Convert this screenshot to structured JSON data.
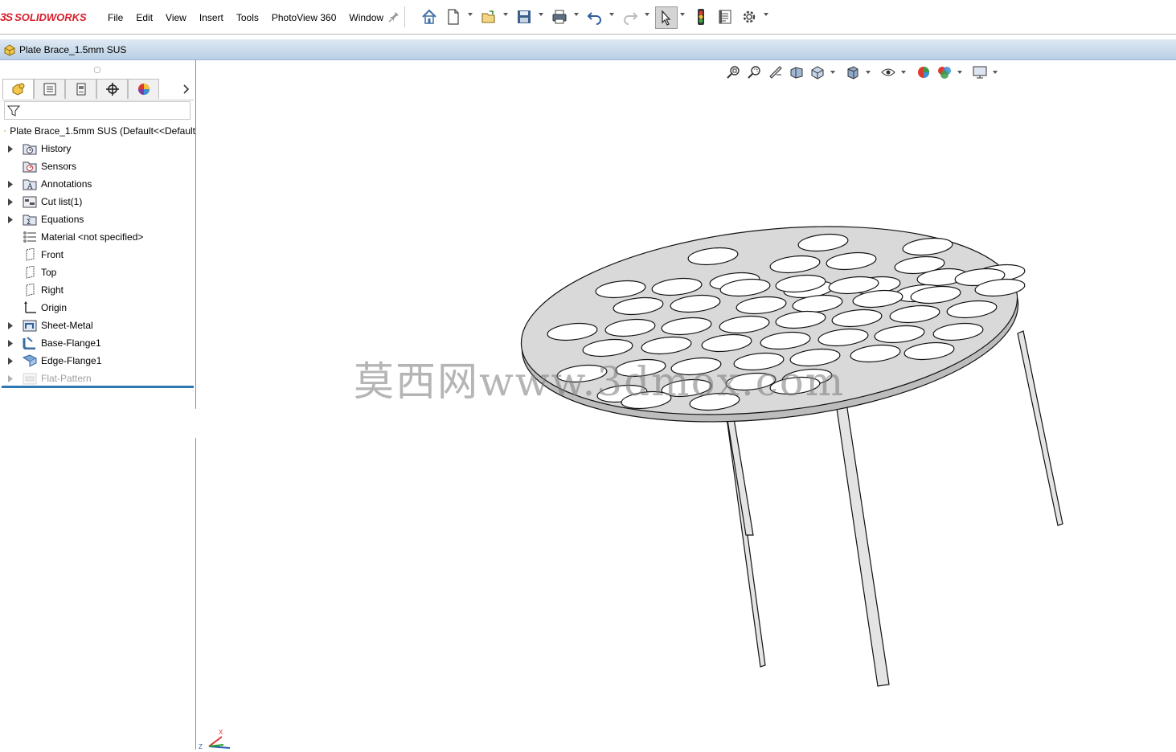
{
  "app": {
    "logo_prefix": "3S",
    "logo_name": "SOLIDWORKS"
  },
  "menu": [
    "File",
    "Edit",
    "View",
    "Insert",
    "Tools",
    "PhotoView 360",
    "Window"
  ],
  "toolbar": {
    "icons": [
      "home-icon",
      "new-document-icon",
      "open-icon",
      "save-icon",
      "print-icon",
      "undo-icon",
      "redo-icon",
      "select-icon",
      "rebuild-icon",
      "file-properties-icon",
      "options-icon"
    ],
    "selected": "select-icon"
  },
  "document": {
    "title": "Plate Brace_1.5mm SUS"
  },
  "feature_manager": {
    "tabs": [
      "feature-manager-tab",
      "property-manager-tab",
      "configuration-manager-tab",
      "dimxpert-manager-tab",
      "display-manager-tab"
    ],
    "root_label": "Plate Brace_1.5mm SUS  (Default<<Default",
    "items": [
      {
        "label": "History",
        "icon": "history-folder-icon",
        "expandable": true
      },
      {
        "label": "Sensors",
        "icon": "sensors-icon",
        "expandable": false
      },
      {
        "label": "Annotations",
        "icon": "annotations-icon",
        "expandable": true
      },
      {
        "label": "Cut list(1)",
        "icon": "cut-list-icon",
        "expandable": true
      },
      {
        "label": "Equations",
        "icon": "equations-icon",
        "expandable": true
      },
      {
        "label": "Material <not specified>",
        "icon": "material-icon",
        "expandable": false
      },
      {
        "label": "Front",
        "icon": "plane-icon",
        "expandable": false
      },
      {
        "label": "Top",
        "icon": "plane-icon",
        "expandable": false
      },
      {
        "label": "Right",
        "icon": "plane-icon",
        "expandable": false
      },
      {
        "label": "Origin",
        "icon": "origin-icon",
        "expandable": false
      },
      {
        "label": "Sheet-Metal",
        "icon": "sheet-metal-icon",
        "expandable": true
      },
      {
        "label": "Base-Flange1",
        "icon": "base-flange-icon",
        "expandable": true
      },
      {
        "label": "Edge-Flange1",
        "icon": "edge-flange-icon",
        "expandable": true
      },
      {
        "label": "Flat-Pattern",
        "icon": "flat-pattern-icon",
        "expandable": true,
        "suppressed": true
      }
    ]
  },
  "heads_up_toolbar": [
    "zoom-to-fit-icon",
    "zoom-to-area-icon",
    "previous-view-icon",
    "section-view-icon",
    "view-orientation-icon",
    "display-style-icon",
    "hide-show-items-icon",
    "edit-appearance-icon",
    "apply-scene-icon",
    "view-settings-icon"
  ],
  "triad": {
    "x_label": "X",
    "z_label": "Z"
  },
  "watermark": "莫西网www.3dmox.com",
  "colors": {
    "accent": "#2f77b3",
    "brand": "#d81e2c",
    "part_fill": "#d9d9d9"
  }
}
